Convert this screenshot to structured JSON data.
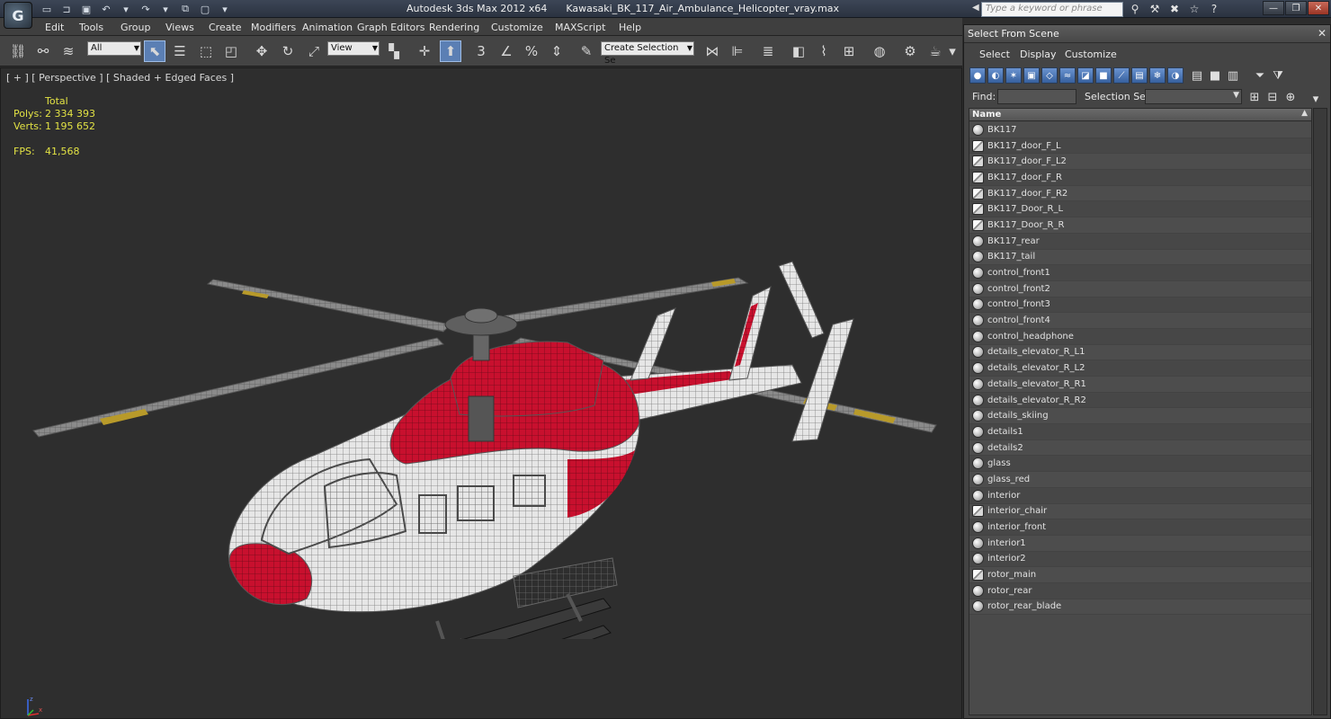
{
  "titlebar": {
    "app_title": "Autodesk 3ds Max  2012 x64",
    "file_name": "Kawasaki_BK_117_Air_Ambulance_Helicopter_vray.max",
    "search_placeholder": "Type a keyword or phrase",
    "logo_letter": "G"
  },
  "menu": [
    "Edit",
    "Tools",
    "Group",
    "Views",
    "Create",
    "Modifiers",
    "Animation",
    "Graph Editors",
    "Rendering",
    "Customize",
    "MAXScript",
    "Help"
  ],
  "toolbar": {
    "filter_value": "All",
    "ref_coord_value": "View",
    "selection_set_placeholder": "Create Selection Se"
  },
  "viewport": {
    "label": "[ + ] [ Perspective ] [ Shaded + Edged Faces ]",
    "stats": {
      "total_label": "Total",
      "polys_label": "Polys:",
      "polys_value": "2 334 393",
      "verts_label": "Verts:",
      "verts_value": "1 195 652",
      "fps_label": "FPS:",
      "fps_value": "41,568"
    },
    "axis": {
      "z": "z",
      "x": "x"
    }
  },
  "dialog": {
    "title": "Select From Scene",
    "menu": [
      "Select",
      "Display",
      "Customize"
    ],
    "find_label": "Find:",
    "find_value": "",
    "selection_set_label": "Selection Set:",
    "selection_set_value": "",
    "column_name": "Name",
    "objects": [
      {
        "name": "BK117",
        "icon": "sphere-icon"
      },
      {
        "name": "BK117_door_F_L",
        "icon": "group-icon"
      },
      {
        "name": "BK117_door_F_L2",
        "icon": "group-icon"
      },
      {
        "name": "BK117_door_F_R",
        "icon": "group-icon"
      },
      {
        "name": "BK117_door_F_R2",
        "icon": "group-icon"
      },
      {
        "name": "BK117_Door_R_L",
        "icon": "group-icon"
      },
      {
        "name": "BK117_Door_R_R",
        "icon": "group-icon"
      },
      {
        "name": "BK117_rear",
        "icon": "sphere-icon"
      },
      {
        "name": "BK117_tail",
        "icon": "sphere-icon"
      },
      {
        "name": "control_front1",
        "icon": "sphere-icon"
      },
      {
        "name": "control_front2",
        "icon": "sphere-icon"
      },
      {
        "name": "control_front3",
        "icon": "sphere-icon"
      },
      {
        "name": "control_front4",
        "icon": "sphere-icon"
      },
      {
        "name": "control_headphone",
        "icon": "sphere-icon"
      },
      {
        "name": "details_elevator_R_L1",
        "icon": "sphere-icon"
      },
      {
        "name": "details_elevator_R_L2",
        "icon": "sphere-icon"
      },
      {
        "name": "details_elevator_R_R1",
        "icon": "sphere-icon"
      },
      {
        "name": "details_elevator_R_R2",
        "icon": "sphere-icon"
      },
      {
        "name": "details_skiing",
        "icon": "sphere-icon"
      },
      {
        "name": "details1",
        "icon": "sphere-icon"
      },
      {
        "name": "details2",
        "icon": "sphere-icon"
      },
      {
        "name": "glass",
        "icon": "sphere-icon"
      },
      {
        "name": "glass_red",
        "icon": "sphere-icon"
      },
      {
        "name": "interior",
        "icon": "sphere-icon"
      },
      {
        "name": "interior_chair",
        "icon": "group-icon"
      },
      {
        "name": "interior_front",
        "icon": "sphere-icon"
      },
      {
        "name": "interior1",
        "icon": "sphere-icon"
      },
      {
        "name": "interior2",
        "icon": "sphere-icon"
      },
      {
        "name": "rotor_main",
        "icon": "group-icon"
      },
      {
        "name": "rotor_rear",
        "icon": "sphere-icon"
      },
      {
        "name": "rotor_rear_blade",
        "icon": "sphere-icon"
      }
    ]
  },
  "colors": {
    "viewport_bg": "#2e2e2e",
    "stats_text": "#e2e244",
    "helicopter_red": "#c8102e",
    "helicopter_white": "#e6e6e6",
    "accent_blue": "#5b7fb4"
  }
}
